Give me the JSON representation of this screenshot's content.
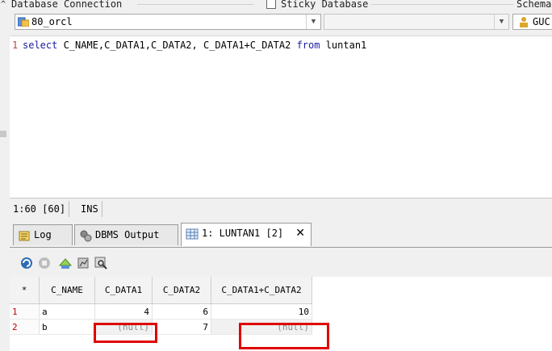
{
  "toolbar": {
    "db_connection_label": "Database Connection",
    "sticky_label": "Sticky Database",
    "schema_label": "Schema",
    "connection_value": "80_orcl",
    "database_value": "",
    "schema_value": "GUC"
  },
  "editor": {
    "line_number": "1",
    "tokens": {
      "select": "select",
      "columns": " C_NAME,C_DATA1,C_DATA2, C_DATA1+C_DATA2 ",
      "from": "from",
      "table": " luntan1"
    }
  },
  "status": {
    "position": "1:60",
    "offset": "[60]",
    "mode": "INS"
  },
  "tabs": [
    {
      "label": "Log"
    },
    {
      "label": "DBMS Output"
    },
    {
      "label": "1: LUNTAN1 [2]",
      "close": "✕"
    }
  ],
  "grid": {
    "corner": "*",
    "columns": [
      "C_NAME",
      "C_DATA1",
      "C_DATA2",
      "C_DATA1+C_DATA2"
    ],
    "rows": [
      {
        "num": "1",
        "c_name": "a",
        "c_data1": "4",
        "c_data2": "6",
        "sum": "10"
      },
      {
        "num": "2",
        "c_name": "b",
        "c_data1": "(null)",
        "c_data2": "7",
        "sum": "(null)"
      }
    ]
  },
  "colors": {
    "keyword": "#1a1aa6",
    "highlight": "#e00000",
    "row_number": "#c00000"
  }
}
